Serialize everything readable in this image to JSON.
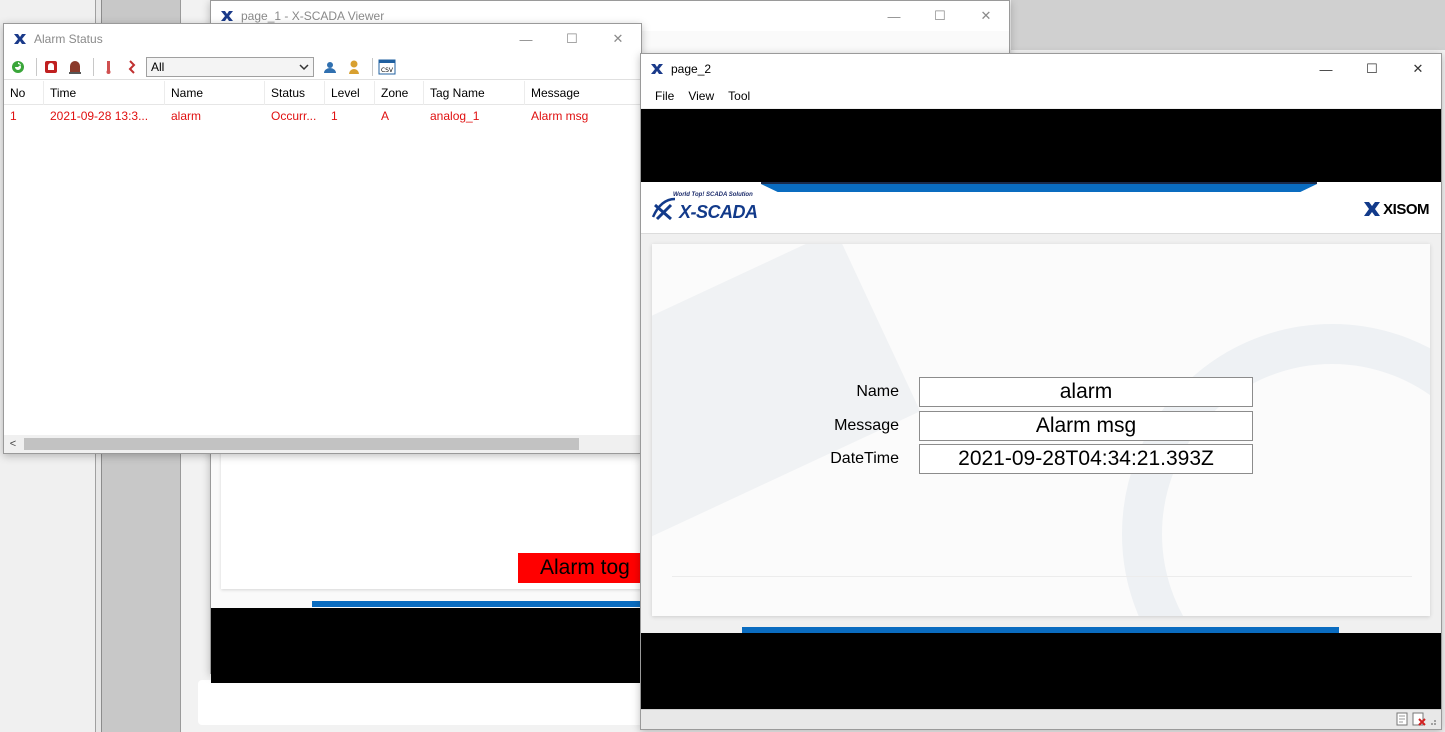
{
  "page1_window": {
    "title": "page_1 - X-SCADA Viewer",
    "alarm_toggle_label": "Alarm tog"
  },
  "alarm_window": {
    "title": "Alarm Status",
    "filter_value": "All",
    "columns": [
      "No",
      "Time",
      "Name",
      "Status",
      "Level",
      "Zone",
      "Tag Name",
      "Message"
    ],
    "rows": [
      [
        "1",
        "2021-09-28 13:3...",
        "alarm",
        "Occurr...",
        "1",
        "A",
        "analog_1",
        "Alarm msg"
      ]
    ],
    "row_color": "#e01010"
  },
  "page2_window": {
    "title": "page_2",
    "menu": [
      "File",
      "View",
      "Tool"
    ],
    "brand_left": "X-SCADA",
    "brand_tagline": "World Top! SCADA Solution",
    "brand_right": "XISOM",
    "fields": [
      {
        "label": "Name",
        "value": "alarm"
      },
      {
        "label": "Message",
        "value": "Alarm msg"
      },
      {
        "label": "DateTime",
        "value": "2021-09-28T04:34:21.393Z"
      }
    ]
  },
  "window_controls": {
    "minimize": "—",
    "maximize": "☐",
    "close": "✕"
  },
  "colors": {
    "accent_blue": "#0a6cc0",
    "alarm_red": "#ff0000",
    "brand_navy": "#123a8a"
  }
}
